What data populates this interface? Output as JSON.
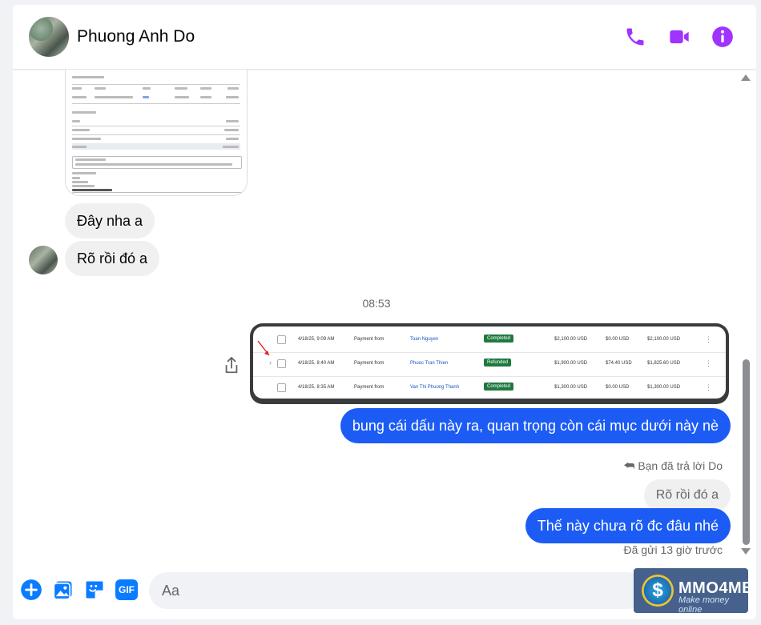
{
  "header": {
    "contact_name": "Phuong Anh Do",
    "icons": [
      "phone-icon",
      "video-camera-icon",
      "info-icon"
    ],
    "accent_color": "#a033ff"
  },
  "messages": {
    "received_1": "Đây nha a",
    "received_2": "Rõ rồi đó a",
    "timestamp": "08:53",
    "sent_1": "bung cái dấu này ra, quan trọng còn cái mục dưới này nè",
    "replied_note": "Bạn đã trả lời Do",
    "reply_quote": "Rõ rồi đó a",
    "sent_2": "Thế này chưa rõ đc đâu nhé",
    "sent_status": "Đã gửi 13 giờ trước"
  },
  "transactions_image": {
    "rows": [
      {
        "date": "4/18/25, 9:09 AM",
        "type": "Payment from",
        "name": "Toan Nguyen",
        "status": "Completed",
        "gross": "$2,100.00 USD",
        "fee": "$0.00 USD",
        "net": "$2,100.00 USD"
      },
      {
        "date": "4/18/25, 8:40 AM",
        "type": "Payment from",
        "name": "Phuoc Tran Thien",
        "status": "Refunded",
        "gross": "$1,900.00 USD",
        "fee": "$74.40 USD",
        "net": "$1,825.60 USD"
      },
      {
        "date": "4/18/25, 8:35 AM",
        "type": "Payment from",
        "name": "Van Thi Phuong Thanh",
        "status": "Completed",
        "gross": "$1,300.00 USD",
        "fee": "$0.00 USD",
        "net": "$1,300.00 USD"
      }
    ]
  },
  "composer": {
    "placeholder": "Aa",
    "icons": [
      "plus-icon",
      "image-icon",
      "sticker-icon",
      "gif-icon"
    ],
    "gif_label": "GIF",
    "accent_color": "#0a7cff"
  },
  "watermark": {
    "title": "MMO4ME",
    "subtitle": "Make money online",
    "coin_symbol": "$"
  },
  "colors": {
    "sent_bubble": "#1c5cf5",
    "received_bubble": "#f0f0f0"
  }
}
